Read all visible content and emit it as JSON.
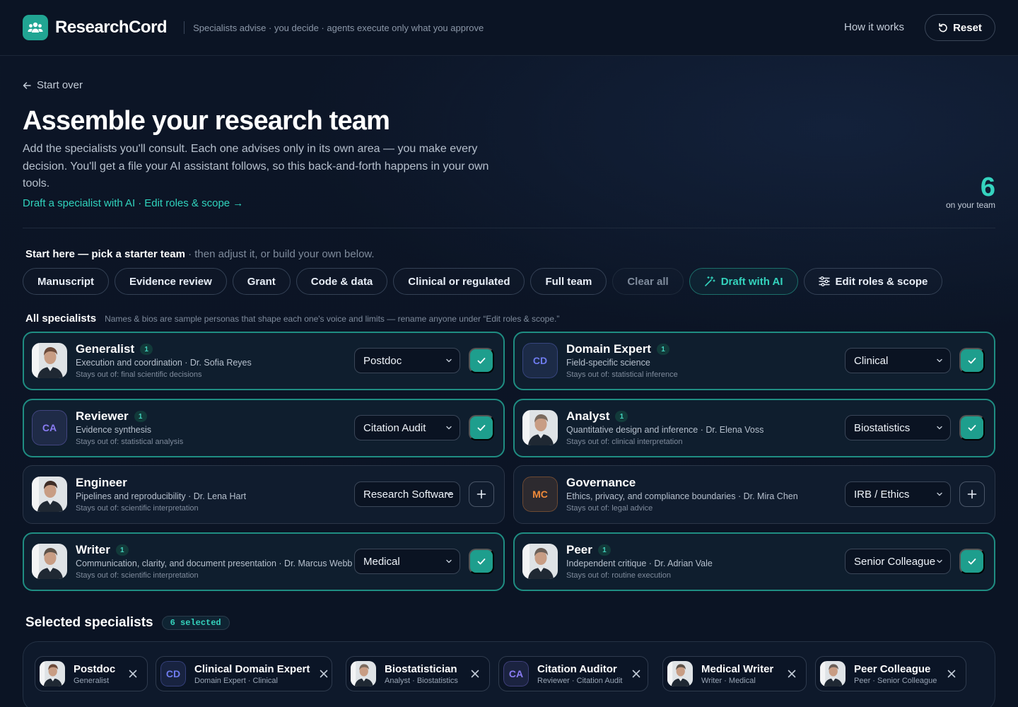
{
  "header": {
    "brand": "ResearchCord",
    "tagline": "Specialists advise · you decide · agents execute only what you approve",
    "how_it_works": "How it works",
    "reset": "Reset"
  },
  "hero": {
    "start_over": "Start over",
    "title": "Assemble your research team",
    "intro": "Add the specialists you'll consult. Each one advises only in its own area — you make every decision. You'll get a file your AI assistant follows, so this back-and-forth happens in your own tools.",
    "link_draft": "Draft a specialist with AI",
    "link_sep": "·",
    "link_edit": "Edit roles & scope →",
    "team_count": "6",
    "team_count_label": "on your team"
  },
  "starter": {
    "heading": "Start here — pick a starter team",
    "hint": " · then adjust it, or build your own below.",
    "pills": [
      "Manuscript",
      "Evidence review",
      "Grant",
      "Code & data",
      "Clinical or regulated",
      "Full team"
    ],
    "clear_all": "Clear all",
    "draft_ai": "Draft with AI",
    "edit_roles": "Edit roles & scope"
  },
  "all_specialists": {
    "heading": "All specialists",
    "note": "Names & bios are sample personas that shape each one's voice and limits — rename anyone under “Edit roles & scope.”"
  },
  "specialists": [
    {
      "role": "Generalist",
      "count": "1",
      "desc": "Execution and coordination · Dr. Sofia Reyes",
      "stays_out": "Stays out of: final scientific decisions",
      "variant": "Postdoc",
      "selected": true,
      "avatar": "photo",
      "tone": "#6b4a3a"
    },
    {
      "role": "Domain Expert",
      "count": "1",
      "desc": "Field-specific science",
      "stays_out": "Stays out of: statistical inference",
      "variant": "Clinical",
      "selected": true,
      "avatar": "CD",
      "tone": "#6f7cf0"
    },
    {
      "role": "Reviewer",
      "count": "1",
      "desc": "Evidence synthesis",
      "stays_out": "Stays out of: statistical analysis",
      "variant": "Citation Audit",
      "selected": true,
      "avatar": "CA",
      "tone": "#8a7cf3"
    },
    {
      "role": "Analyst",
      "count": "1",
      "desc": "Quantitative design and inference · Dr. Elena Voss",
      "stays_out": "Stays out of: clinical interpretation",
      "variant": "Biostatistics",
      "selected": true,
      "avatar": "photo",
      "tone": "#7a6a5e"
    },
    {
      "role": "Engineer",
      "count": "",
      "desc": "Pipelines and reproducibility · Dr. Lena Hart",
      "stays_out": "Stays out of: scientific interpretation",
      "variant": "Research Software",
      "selected": false,
      "avatar": "photo",
      "tone": "#3d2c26"
    },
    {
      "role": "Governance",
      "count": "",
      "desc": "Ethics, privacy, and compliance boundaries · Dr. Mira Chen",
      "stays_out": "Stays out of: legal advice",
      "variant": "IRB / Ethics",
      "selected": false,
      "avatar": "MC",
      "tone": "#f08a3a"
    },
    {
      "role": "Writer",
      "count": "1",
      "desc": "Communication, clarity, and document presentation · Dr. Marcus Webb",
      "stays_out": "Stays out of: scientific interpretation",
      "variant": "Medical",
      "selected": true,
      "avatar": "photo",
      "tone": "#5c5148"
    },
    {
      "role": "Peer",
      "count": "1",
      "desc": "Independent critique · Dr. Adrian Vale",
      "stays_out": "Stays out of: routine execution",
      "variant": "Senior Colleague",
      "selected": true,
      "avatar": "photo",
      "tone": "#6a5f58"
    }
  ],
  "selected": {
    "heading": "Selected specialists",
    "count_label": "6 selected",
    "chips": [
      {
        "name": "Postdoc",
        "sub": "Generalist",
        "avatar": "photo",
        "tone": "#6b4a3a"
      },
      {
        "name": "Clinical Domain Expert",
        "sub": "Domain Expert · Clinical",
        "avatar": "CD",
        "tone": "#6f7cf0"
      },
      {
        "name": "Biostatistician",
        "sub": "Analyst · Biostatistics",
        "avatar": "photo",
        "tone": "#7a6a5e"
      },
      {
        "name": "Citation Auditor",
        "sub": "Reviewer · Citation Audit",
        "avatar": "CA",
        "tone": "#8a7cf3"
      },
      {
        "name": "Medical Writer",
        "sub": "Writer · Medical",
        "avatar": "photo",
        "tone": "#5c5148"
      },
      {
        "name": "Peer Colleague",
        "sub": "Peer · Senior Colleague",
        "avatar": "photo",
        "tone": "#6a5f58"
      }
    ]
  },
  "colors": {
    "accent": "#21a593",
    "accent_text": "#34d3bd",
    "background": "#0b1424"
  }
}
